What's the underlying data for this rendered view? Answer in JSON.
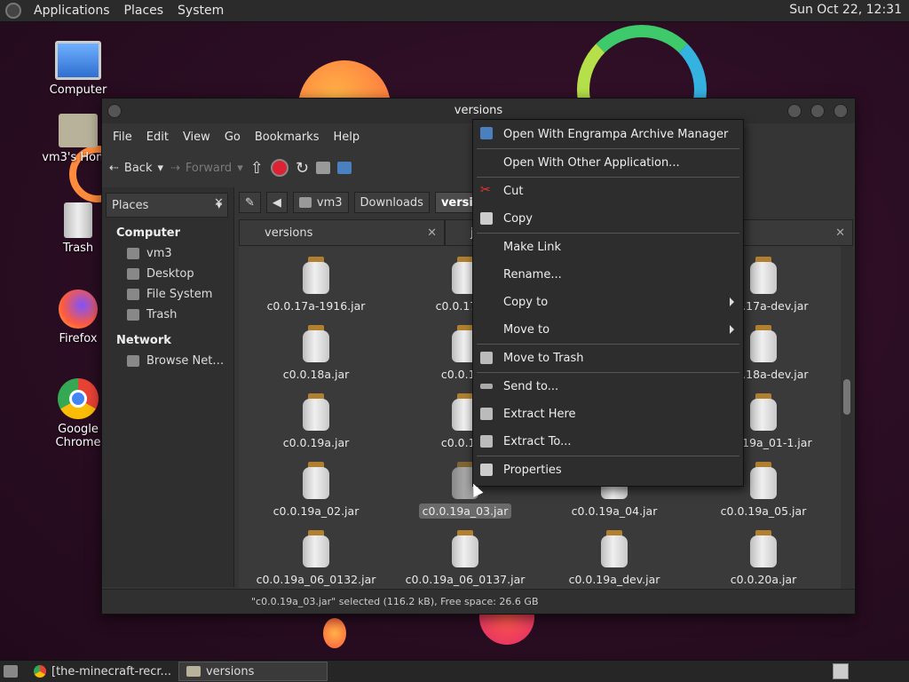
{
  "top_panel": {
    "menus": [
      "Applications",
      "Places",
      "System"
    ],
    "clock": "Sun Oct 22, 12:31"
  },
  "desktop_icons": [
    "Computer",
    "vm3's Home",
    "Trash",
    "Firefox",
    "Google Chrome"
  ],
  "window": {
    "title": "versions",
    "menubar": [
      "File",
      "Edit",
      "View",
      "Go",
      "Bookmarks",
      "Help"
    ],
    "toolbar": {
      "back": "Back",
      "forward": "Forward"
    },
    "sidebar": {
      "header": "Places",
      "computer_label": "Computer",
      "computer_items": [
        "vm3",
        "Desktop",
        "File System",
        "Trash"
      ],
      "network_label": "Network",
      "network_items": [
        "Browse Net…"
      ]
    },
    "path": [
      "vm3",
      "Downloads",
      "versions"
    ],
    "tabs": [
      "versions",
      "jar"
    ],
    "files": [
      "c0.0.17a-1916.jar",
      "c0.0.17a-2",
      "c0.0.17a-dev.jar",
      "c0.0.18a.jar",
      "c0.0.18a",
      "c0.0.18a-dev.jar",
      "c0.0.19a.jar",
      "c0.0.19a",
      "c0.0.19a_01-1.jar",
      "c0.0.19a_02.jar",
      "c0.0.19a_03.jar",
      "c0.0.19a_04.jar",
      "c0.0.19a_05.jar",
      "c0.0.19a_06_0132.jar",
      "c0.0.19a_06_0137.jar",
      "c0.0.19a_dev.jar",
      "c0.0.20a.jar"
    ],
    "status": "\"c0.0.19a_03.jar\" selected (116.2 kB), Free space: 26.6 GB"
  },
  "context_menu": {
    "items": [
      "Open With Engrampa Archive Manager",
      "Open With Other Application...",
      "Cut",
      "Copy",
      "Make Link",
      "Rename...",
      "Copy to",
      "Move to",
      "Move to Trash",
      "Send to...",
      "Extract Here",
      "Extract To...",
      "Properties"
    ]
  },
  "taskbar": {
    "tasks": [
      "[the-minecraft-recr...",
      "versions"
    ]
  }
}
